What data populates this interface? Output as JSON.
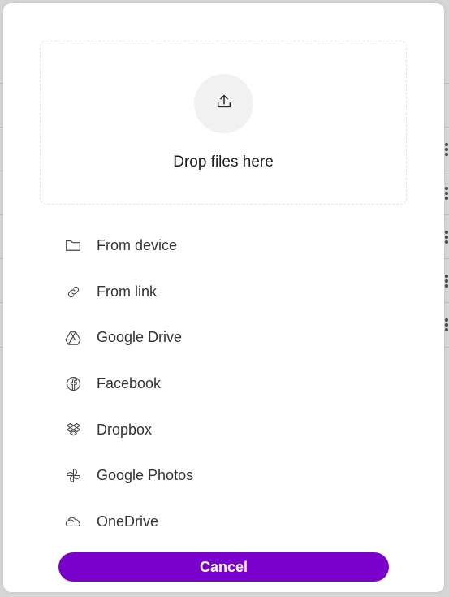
{
  "dropzone": {
    "label": "Drop files here",
    "icon": "upload-icon"
  },
  "sources": [
    {
      "label": "From device",
      "icon": "folder-icon"
    },
    {
      "label": "From link",
      "icon": "link-icon"
    },
    {
      "label": "Google Drive",
      "icon": "google-drive-icon"
    },
    {
      "label": "Facebook",
      "icon": "facebook-icon"
    },
    {
      "label": "Dropbox",
      "icon": "dropbox-icon"
    },
    {
      "label": "Google Photos",
      "icon": "google-photos-icon"
    },
    {
      "label": "OneDrive",
      "icon": "onedrive-icon"
    }
  ],
  "cancel_label": "Cancel",
  "colors": {
    "accent": "#7a00cc",
    "overlay": "#d6d6d6",
    "text": "#333333"
  }
}
